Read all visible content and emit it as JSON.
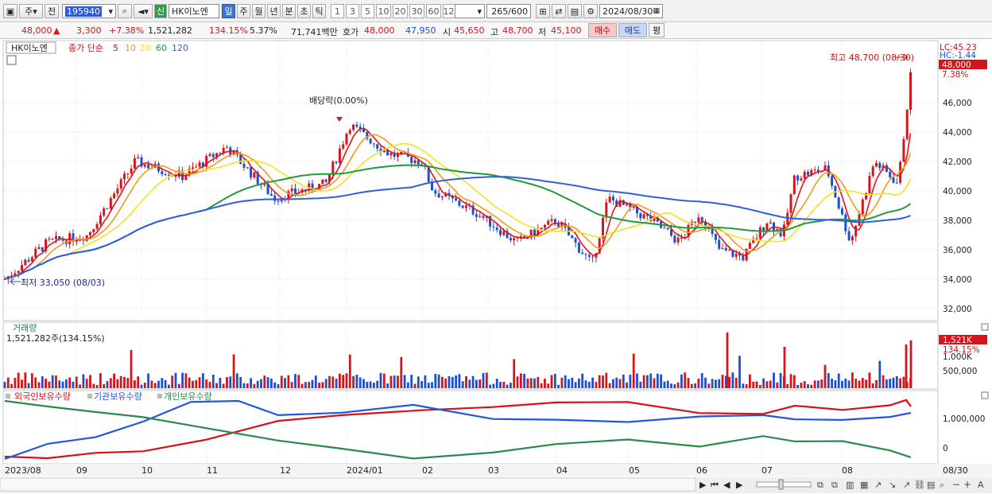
{
  "toolbar": {
    "type_label": "주",
    "prev_label": "전",
    "code": "195940",
    "badge": "신",
    "name": "HK이노엔",
    "periods": [
      "일",
      "주",
      "월",
      "년",
      "분",
      "초",
      "틱"
    ],
    "numbers": [
      "1",
      "3",
      "5",
      "10",
      "20",
      "30",
      "60",
      "120"
    ],
    "count": "265",
    "count_total": "/600",
    "date": "2024/08/30"
  },
  "quote": {
    "price": "48,000",
    "arrow": "▲",
    "change": "3,300",
    "rate": "+7.38%",
    "volume": "1,521,282",
    "vol_rate": "134.15%",
    "turnover": "5.37%",
    "amount": "71,741백만",
    "bid_label": "호가",
    "ask": "48,000",
    "bid": "47,950",
    "open_label": "시",
    "open": "45,650",
    "high_label": "고",
    "high": "48,700",
    "low_label": "저",
    "low": "45,100",
    "buy_label": "매수",
    "sell_label": "매도",
    "avg_label": "평"
  },
  "legend": {
    "stock": "HK이노엔",
    "ma_label": "종가 단순",
    "ma_periods": [
      "5",
      "10",
      "20",
      "60",
      "120"
    ],
    "ma_colors": [
      "#e8101a",
      "#f39a1a",
      "#f5e21c",
      "#1e9b3a",
      "#2f5fe0"
    ]
  },
  "annotations": {
    "high_note": "최고 48,700 (08/30)",
    "low_note": "최저 33,050 (08/03)",
    "dividend_note": "배당락(0.00%)",
    "lc": "LC:45.23",
    "hc": "HC:-1.44",
    "price_tag": "48,000",
    "rate_tag": "7.38%",
    "volume_title": "거래량",
    "volume_value": "1,521,282주(134.15%)",
    "volume_tag": "1,521K",
    "volume_rate_tag": "134.15%",
    "holdings_legend": [
      "외국인보유수량",
      "기관보유수량",
      "개인보유수량"
    ],
    "holdings_colors": [
      "#d8101a",
      "#2256e0",
      "#2a8a4a"
    ]
  },
  "axis": {
    "price_ticks": [
      "48,000",
      "46,000",
      "44,000",
      "42,000",
      "40,000",
      "38,000",
      "36,000",
      "34,000",
      "32,000"
    ],
    "volume_ticks": [
      "1,000K",
      "500,000"
    ],
    "holding_ticks": [
      "1,000,000",
      "0"
    ],
    "month_labels": [
      "2023/08",
      "09",
      "10",
      "11",
      "12",
      "2024/01",
      "02",
      "03",
      "04",
      "05",
      "06",
      "07",
      "08"
    ],
    "last_date": "08/30"
  },
  "colors": {
    "up": "#d5151b",
    "down": "#1d4fd1",
    "grid": "#e0e0e0"
  }
}
